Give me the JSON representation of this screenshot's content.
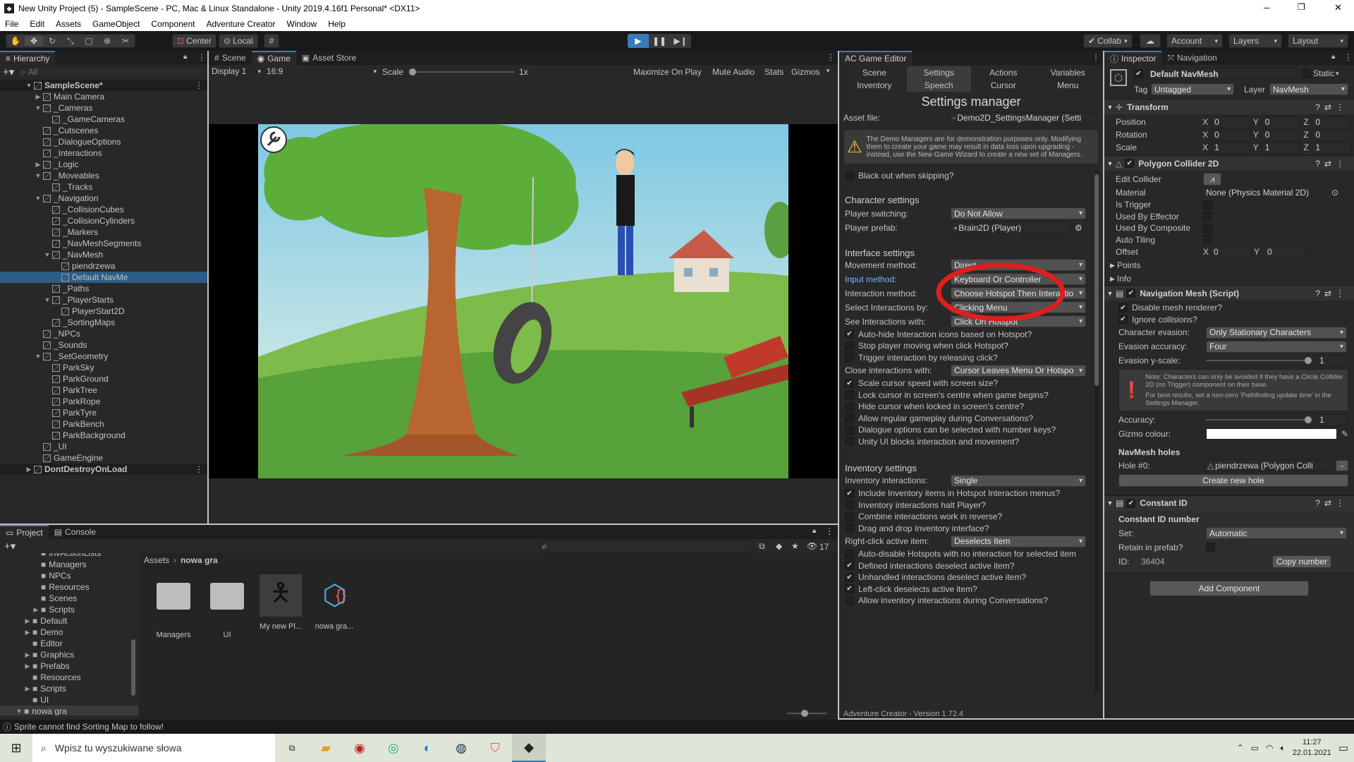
{
  "window": {
    "title": "New Unity Project (5) - SampleScene - PC, Mac & Linux Standalone - Unity 2019.4.16f1 Personal* <DX11>",
    "min": "─",
    "max": "❐",
    "close": "✕"
  },
  "menu": [
    "File",
    "Edit",
    "Assets",
    "GameObject",
    "Component",
    "Adventure Creator",
    "Window",
    "Help"
  ],
  "toolbar": {
    "pivot": "Center",
    "space": "Local",
    "collab": "Collab",
    "account": "Account",
    "layers": "Layers",
    "layout": "Layout"
  },
  "hierarchy": {
    "tab": "Hierarchy",
    "search_placeholder": "All",
    "items": [
      {
        "label": "SampleScene*",
        "depth": 0,
        "arrow": "▼",
        "kind": "scene"
      },
      {
        "label": "Main Camera",
        "depth": 1,
        "arrow": "▶"
      },
      {
        "label": "_Cameras",
        "depth": 1,
        "arrow": "▼"
      },
      {
        "label": "_GameCameras",
        "depth": 2,
        "arrow": ""
      },
      {
        "label": "_Cutscenes",
        "depth": 1,
        "arrow": ""
      },
      {
        "label": "_DialogueOptions",
        "depth": 1,
        "arrow": ""
      },
      {
        "label": "_Interactions",
        "depth": 1,
        "arrow": ""
      },
      {
        "label": "_Logic",
        "depth": 1,
        "arrow": "▶"
      },
      {
        "label": "_Moveables",
        "depth": 1,
        "arrow": "▼"
      },
      {
        "label": "_Tracks",
        "depth": 2,
        "arrow": ""
      },
      {
        "label": "_Navigation",
        "depth": 1,
        "arrow": "▼"
      },
      {
        "label": "_CollisionCubes",
        "depth": 2,
        "arrow": ""
      },
      {
        "label": "_CollisionCylinders",
        "depth": 2,
        "arrow": ""
      },
      {
        "label": "_Markers",
        "depth": 2,
        "arrow": ""
      },
      {
        "label": "_NavMeshSegments",
        "depth": 2,
        "arrow": ""
      },
      {
        "label": "_NavMesh",
        "depth": 2,
        "arrow": "▼"
      },
      {
        "label": "piendrzewa",
        "depth": 3,
        "arrow": ""
      },
      {
        "label": "Default NavMe",
        "depth": 3,
        "arrow": "",
        "selected": true
      },
      {
        "label": "_Paths",
        "depth": 2,
        "arrow": ""
      },
      {
        "label": "_PlayerStarts",
        "depth": 2,
        "arrow": "▼"
      },
      {
        "label": "PlayerStart2D",
        "depth": 3,
        "arrow": ""
      },
      {
        "label": "_SortingMaps",
        "depth": 2,
        "arrow": ""
      },
      {
        "label": "_NPCs",
        "depth": 1,
        "arrow": ""
      },
      {
        "label": "_Sounds",
        "depth": 1,
        "arrow": ""
      },
      {
        "label": "_SetGeometry",
        "depth": 1,
        "arrow": "▼"
      },
      {
        "label": "ParkSky",
        "depth": 2,
        "arrow": ""
      },
      {
        "label": "ParkGround",
        "depth": 2,
        "arrow": ""
      },
      {
        "label": "ParkTree",
        "depth": 2,
        "arrow": ""
      },
      {
        "label": "ParkRope",
        "depth": 2,
        "arrow": ""
      },
      {
        "label": "ParkTyre",
        "depth": 2,
        "arrow": ""
      },
      {
        "label": "ParkBench",
        "depth": 2,
        "arrow": ""
      },
      {
        "label": "ParkBackground",
        "depth": 2,
        "arrow": ""
      },
      {
        "label": "_UI",
        "depth": 1,
        "arrow": ""
      },
      {
        "label": "GameEngine",
        "depth": 1,
        "arrow": ""
      },
      {
        "label": "DontDestroyOnLoad",
        "depth": 0,
        "arrow": "▶",
        "kind": "scene"
      }
    ]
  },
  "game": {
    "tabs": [
      "Scene",
      "Game",
      "Asset Store"
    ],
    "display": "Display 1",
    "aspect": "16:9",
    "scale_label": "Scale",
    "scale_value": "1x",
    "maximize": "Maximize On Play",
    "mute": "Mute Audio",
    "stats": "Stats",
    "gizmos": "Gizmos"
  },
  "ac": {
    "tab": "AC Game Editor",
    "nav_row1": [
      "Scene",
      "Settings",
      "Actions",
      "Variables"
    ],
    "nav_row2": [
      "Inventory",
      "Speech",
      "Cursor",
      "Menu"
    ],
    "heading": "Settings manager",
    "asset_label": "Asset file:",
    "asset_value": "Demo2D_SettingsManager (Setti",
    "warning": "The Demo Managers are for demonstration purposes only. Modifying them to create your game may result in data loss upon upgrading - instead, use the New Game Wizard to create a new set of Managers.",
    "blackout": "Black out when skipping?",
    "char_title": "Character settings",
    "player_switching_label": "Player switching:",
    "player_switching": "Do Not Allow",
    "player_prefab_label": "Player prefab:",
    "player_prefab": "Brain2D (Player)",
    "iface_title": "Interface settings",
    "iface": [
      {
        "t": "dd",
        "label": "Movement method:",
        "value": "Direct"
      },
      {
        "t": "dd",
        "label": "Input method:",
        "value": "Keyboard Or Controller",
        "highlight": true
      },
      {
        "t": "dd",
        "label": "Interaction method:",
        "value": "Choose Hotspot Then Interactio"
      },
      {
        "t": "dd",
        "label": "Select Interactions by:",
        "value": "Clicking Menu"
      },
      {
        "t": "dd",
        "label": "See Interactions with:",
        "value": "Click On Hotspot"
      },
      {
        "t": "cb",
        "label": "Auto-hide Interaction icons based on Hotspot?",
        "checked": true
      },
      {
        "t": "cb",
        "label": "Stop player moving when click Hotspot?",
        "checked": false
      },
      {
        "t": "cb",
        "label": "Trigger interaction by releasing click?",
        "checked": false
      },
      {
        "t": "dd",
        "label": "Close interactions with:",
        "value": "Cursor Leaves Menu Or Hotspo"
      },
      {
        "t": "cb",
        "label": "Scale cursor speed with screen size?",
        "checked": true
      },
      {
        "t": "cb",
        "label": "Lock cursor in screen's centre when game begins?",
        "checked": false
      },
      {
        "t": "cb",
        "label": "Hide cursor when locked in screen's centre?",
        "checked": false
      },
      {
        "t": "cb",
        "label": "Allow regular gameplay during Conversations?",
        "checked": false
      },
      {
        "t": "cb",
        "label": "Dialogue options can be selected with number keys?",
        "checked": false
      },
      {
        "t": "cb",
        "label": "Unity UI blocks interaction and movement?",
        "checked": false
      }
    ],
    "inv_title": "Inventory settings",
    "inv": [
      {
        "t": "dd",
        "label": "Inventory interactions:",
        "value": "Single"
      },
      {
        "t": "cb",
        "label": "Include Inventory items in Hotspot Interaction menus?",
        "checked": true
      },
      {
        "t": "cb",
        "label": "Inventory interactions halt Player?",
        "checked": false
      },
      {
        "t": "cb",
        "label": "Combine interactions work in reverse?",
        "checked": false
      },
      {
        "t": "cb",
        "label": "Drag and drop Inventory interface?",
        "checked": false
      },
      {
        "t": "dd",
        "label": "Right-click active item:",
        "value": "Deselects Item"
      },
      {
        "t": "cb",
        "label": "Auto-disable Hotspots with no interaction for selected item",
        "checked": false
      },
      {
        "t": "cb",
        "label": "Defined interactions deselect active item?",
        "checked": true
      },
      {
        "t": "cb",
        "label": "Unhandled interactions deselect active item?",
        "checked": true
      },
      {
        "t": "cb",
        "label": "Left-click deselects active item?",
        "checked": true
      },
      {
        "t": "cb",
        "label": "Allow inventory interactions during Conversations?",
        "checked": false
      }
    ],
    "footer": "Adventure Creator - Version 1.72.4"
  },
  "inspector": {
    "tabs": [
      "Inspector",
      "Navigation"
    ],
    "object_name": "Default NavMesh",
    "static": "Static",
    "tag_label": "Tag",
    "tag": "Untagged",
    "layer_label": "Layer",
    "layer": "NavMesh",
    "transform": {
      "title": "Transform",
      "rows": [
        {
          "label": "Position",
          "x": "0",
          "y": "0",
          "z": "0"
        },
        {
          "label": "Rotation",
          "x": "0",
          "y": "0",
          "z": "0"
        },
        {
          "label": "Scale",
          "x": "1",
          "y": "1",
          "z": "1"
        }
      ]
    },
    "collider": {
      "title": "Polygon Collider 2D",
      "edit": "Edit Collider",
      "material_label": "Material",
      "material": "None (Physics Material 2D)",
      "flags": [
        "Is Trigger",
        "Used By Effector",
        "Used By Composite",
        "Auto Tiling"
      ],
      "offset_label": "Offset",
      "offset_x": "0",
      "offset_y": "0",
      "points": "Points",
      "info": "Info"
    },
    "navmesh": {
      "title": "Navigation Mesh (Script)",
      "disable": "Disable mesh renderer?",
      "ignore": "Ignore collisions?",
      "evasion_label": "Character evasion:",
      "evasion": "Only Stationary Characters",
      "accuracy_label": "Evasion accuracy:",
      "accuracy": "Four",
      "yscale_label": "Evasion y-scale:",
      "yscale": "1",
      "note1": "Note: Characters can only be avoided if they have a Circle Collider 2D (no Trigger) component on their base.",
      "note2": "For best results, set a non-zero 'Pathfinding update time' in the Settings Manager.",
      "acc_label": "Accuracy:",
      "acc": "1",
      "gizmo_label": "Gizmo colour:",
      "holes_title": "NavMesh holes",
      "hole_label": "Hole #0:",
      "hole": "piendrzewa (Polygon Colli",
      "create": "Create new hole"
    },
    "constid": {
      "title": "Constant ID",
      "subtitle": "Constant ID number",
      "set_label": "Set:",
      "set": "Automatic",
      "retain": "Retain in prefab?",
      "id_label": "ID:",
      "id": "36404",
      "copy": "Copy number"
    },
    "add": "Add Component"
  },
  "project": {
    "tabs": [
      "Project",
      "Console"
    ],
    "count": "17",
    "tree": [
      {
        "label": "InvActionLists",
        "depth": 3,
        "arrow": ""
      },
      {
        "label": "Managers",
        "depth": 3,
        "arrow": ""
      },
      {
        "label": "NPCs",
        "depth": 3,
        "arrow": ""
      },
      {
        "label": "Resources",
        "depth": 3,
        "arrow": ""
      },
      {
        "label": "Scenes",
        "depth": 3,
        "arrow": ""
      },
      {
        "label": "Scripts",
        "depth": 3,
        "arrow": "▶"
      },
      {
        "label": "Default",
        "depth": 2,
        "arrow": "▶"
      },
      {
        "label": "Demo",
        "depth": 2,
        "arrow": "▶"
      },
      {
        "label": "Editor",
        "depth": 2,
        "arrow": ""
      },
      {
        "label": "Graphics",
        "depth": 2,
        "arrow": "▶"
      },
      {
        "label": "Prefabs",
        "depth": 2,
        "arrow": "▶"
      },
      {
        "label": "Resources",
        "depth": 2,
        "arrow": ""
      },
      {
        "label": "Scripts",
        "depth": 2,
        "arrow": "▶"
      },
      {
        "label": "UI",
        "depth": 2,
        "arrow": ""
      },
      {
        "label": "nowa gra",
        "depth": 1,
        "arrow": "▼"
      }
    ],
    "breadcrumb": [
      "Assets",
      "nowa gra"
    ],
    "assets": [
      {
        "label": "Managers",
        "kind": "folder"
      },
      {
        "label": "UI",
        "kind": "folder"
      },
      {
        "label": "My new Pl...",
        "kind": "char"
      },
      {
        "label": "nowa gra...",
        "kind": "script"
      }
    ]
  },
  "status": "Sprite cannot find Sorting Map to follow!",
  "taskbar": {
    "search": "Wpisz tu wyszukiwane słowa",
    "time": "11:27",
    "date": "22.01.2021"
  }
}
